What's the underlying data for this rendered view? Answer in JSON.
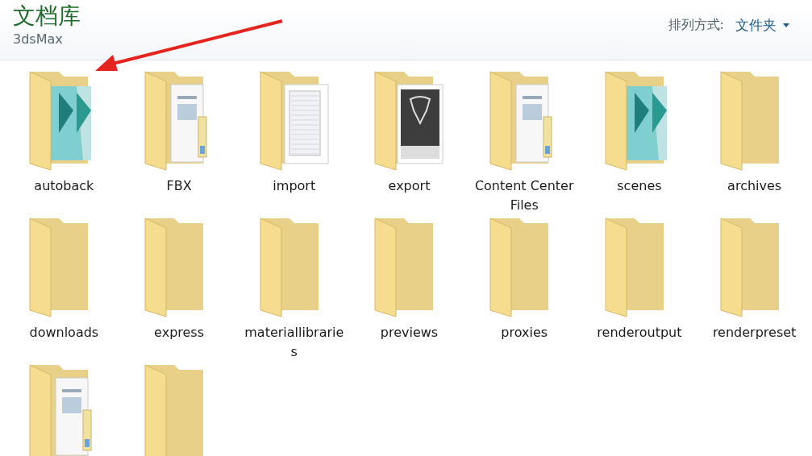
{
  "header": {
    "title": "文档库",
    "subtitle": "3dsMax",
    "arrange_label": "排列方式:",
    "arrange_value": "文件夹"
  },
  "folders": [
    {
      "label": "autoback",
      "kind": "max"
    },
    {
      "label": "FBX",
      "kind": "docs"
    },
    {
      "label": "import",
      "kind": "text"
    },
    {
      "label": "export",
      "kind": "fbx"
    },
    {
      "label": "Content Center Files",
      "kind": "docs"
    },
    {
      "label": "scenes",
      "kind": "max"
    },
    {
      "label": "archives",
      "kind": "plain"
    },
    {
      "label": "downloads",
      "kind": "plain"
    },
    {
      "label": "express",
      "kind": "plain"
    },
    {
      "label": "materiallibraries",
      "kind": "plain"
    },
    {
      "label": "previews",
      "kind": "plain"
    },
    {
      "label": "proxies",
      "kind": "plain"
    },
    {
      "label": "renderoutput",
      "kind": "plain"
    },
    {
      "label": "renderpreset",
      "kind": "plain"
    },
    {
      "kind": "docs"
    },
    {
      "kind": "plain"
    }
  ]
}
